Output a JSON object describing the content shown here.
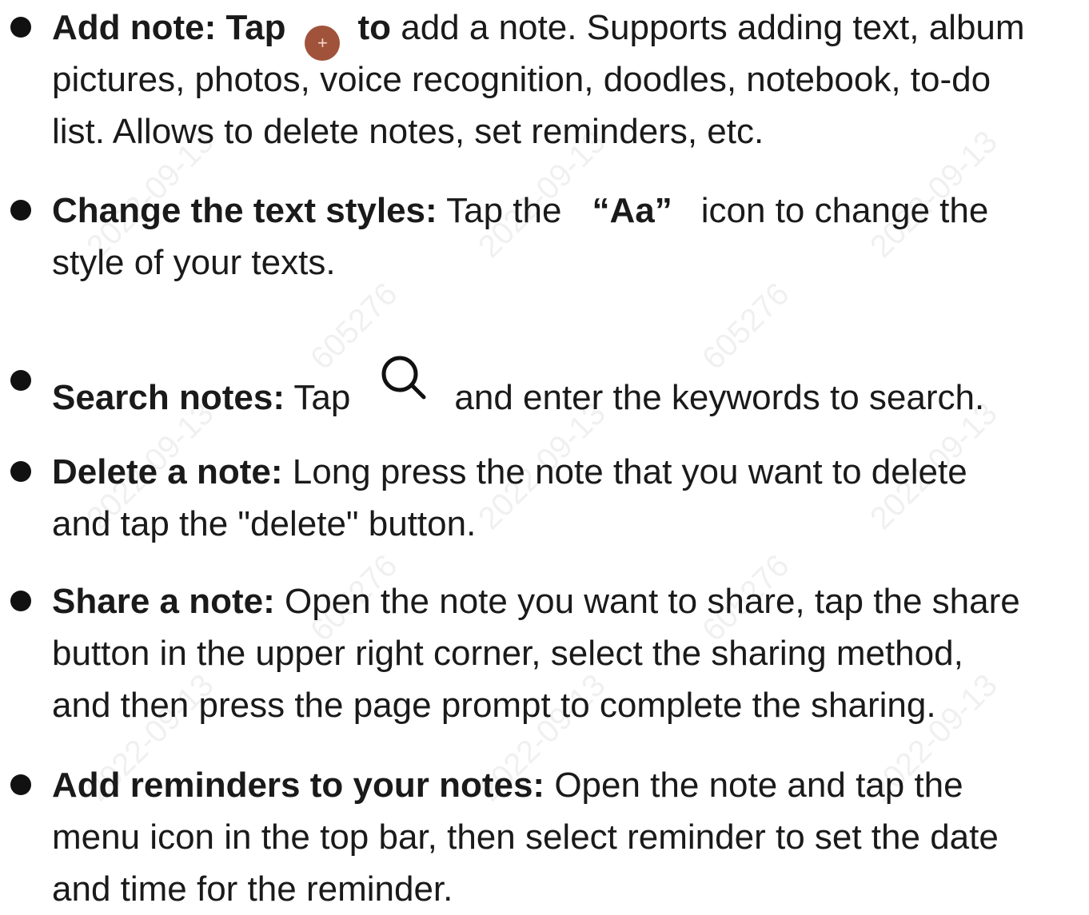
{
  "items": [
    {
      "title": "Add note: Tap",
      "title_after_icon": "to",
      "icon_glyph": "+",
      "lines": [
        "add a note. Supports adding text, album",
        "pictures, photos, voice recognition, doodles, notebook, to-do",
        "list. Allows to delete notes, set reminders, etc."
      ]
    },
    {
      "title": "Change the text styles:",
      "pre_icon_text": "Tap the",
      "icon_text": "“Aa”",
      "post_icon_text": "icon to change the",
      "lines": [
        "style of your texts."
      ]
    },
    {
      "title": "Search notes:",
      "pre_icon_text": "Tap",
      "post_icon_text": "and enter the keywords to search."
    },
    {
      "title": "Delete a note:",
      "first_line_text": "Long press the note that you want to delete",
      "lines": [
        "and tap the \"delete\" button."
      ]
    },
    {
      "title": "Share a note:",
      "first_line_text": "Open the note you want to share, tap the share",
      "lines": [
        "button in the upper right corner, select the sharing method,",
        "and then press the page prompt to complete the sharing."
      ]
    },
    {
      "title": "Add reminders to your notes:",
      "first_line_text": "Open the note and tap the",
      "lines": [
        "menu icon in the top bar, then select reminder to set the date",
        "and time for the reminder."
      ]
    }
  ],
  "icons": {
    "add": "add-circle-icon",
    "search": "search-icon"
  },
  "colors": {
    "text": "#1a1a1a",
    "add_icon_bg": "#a0533a"
  },
  "watermark": {
    "date": "2022-09-13",
    "code": "605276"
  }
}
